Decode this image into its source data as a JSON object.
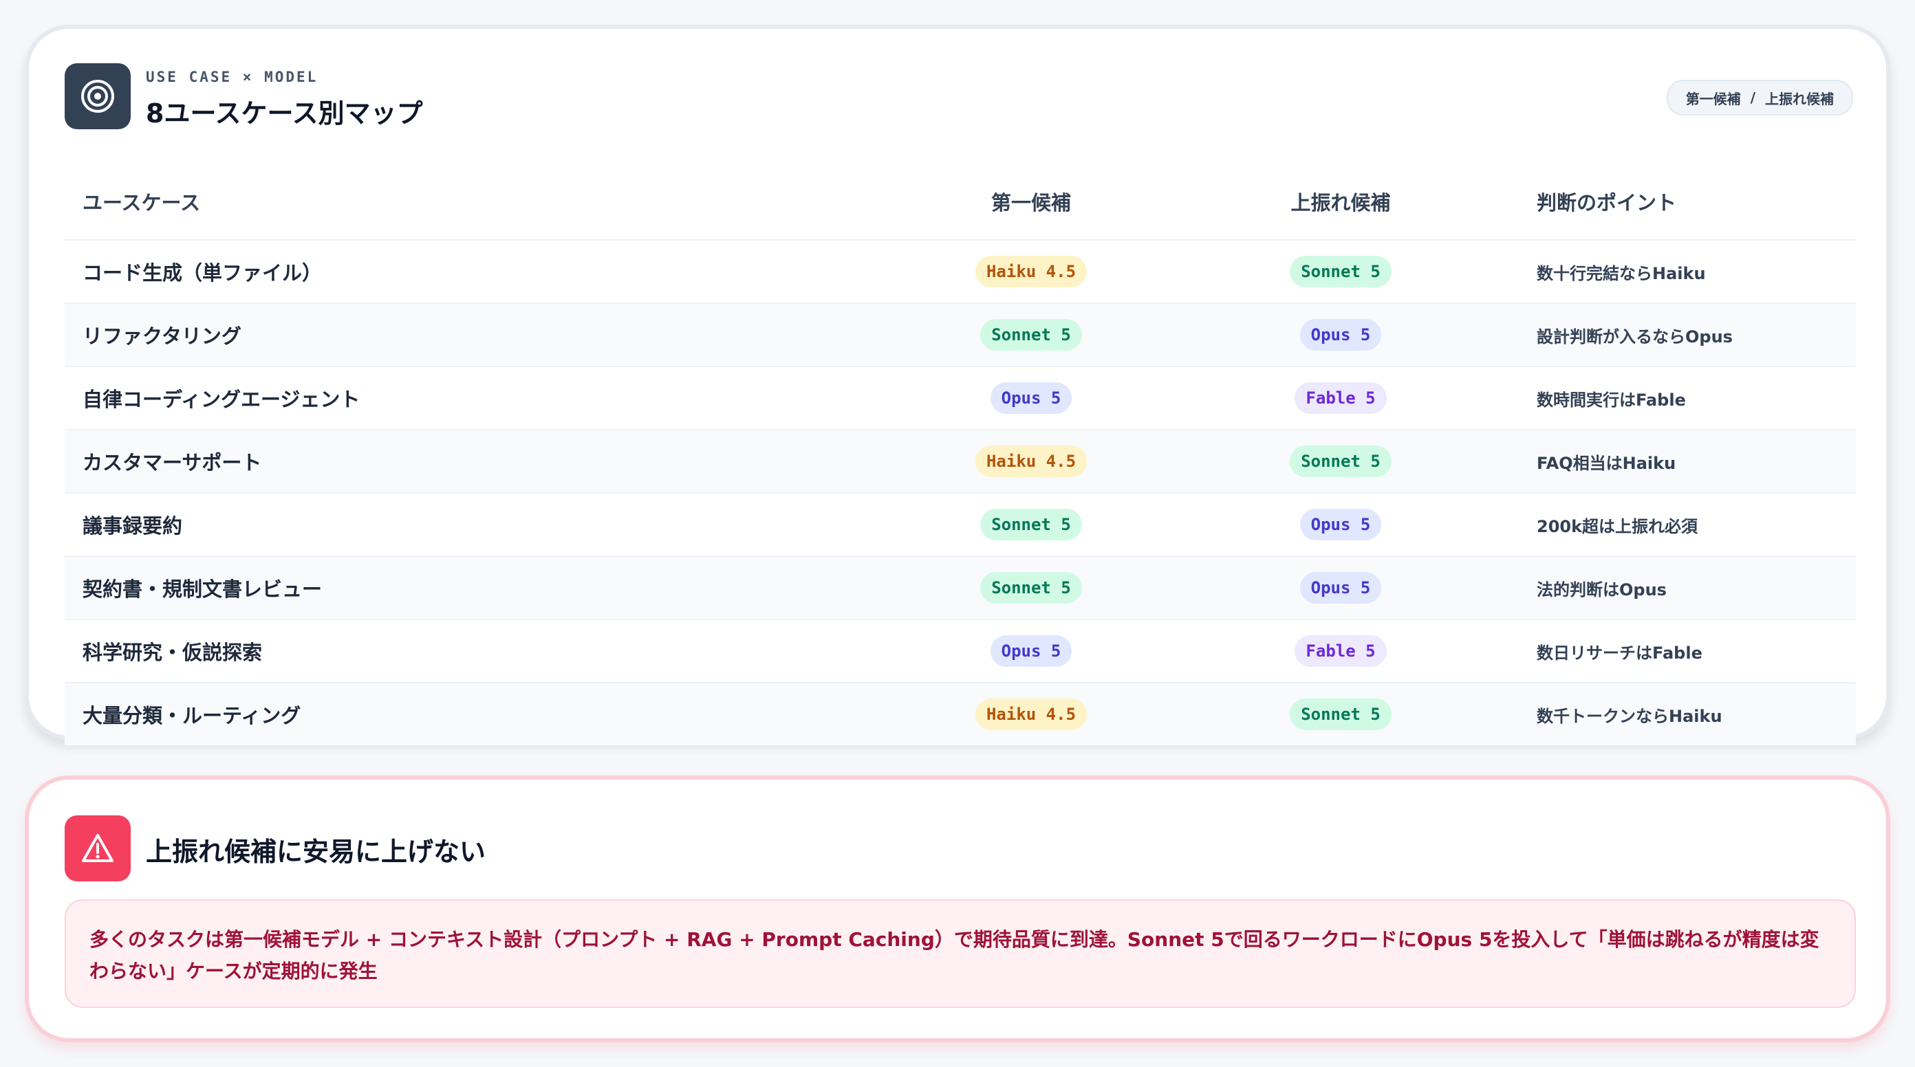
{
  "header": {
    "eyebrow": "USE CASE × MODEL",
    "title": "8ユースケース別マップ",
    "icon": "target-icon",
    "legend": {
      "primary": "第一候補",
      "separator": "/",
      "upgrade": "上振れ候補"
    }
  },
  "table": {
    "columns": [
      "ユースケース",
      "第一候補",
      "上振れ候補",
      "判断のポイント"
    ],
    "rows": [
      {
        "use_case": "コード生成（単ファイル）",
        "primary": "Haiku 4.5",
        "upgrade": "Sonnet 5",
        "point": "数十行完結ならHaiku"
      },
      {
        "use_case": "リファクタリング",
        "primary": "Sonnet 5",
        "upgrade": "Opus 5",
        "point": "設計判断が入るならOpus"
      },
      {
        "use_case": "自律コーディングエージェント",
        "primary": "Opus 5",
        "upgrade": "Fable 5",
        "point": "数時間実行はFable"
      },
      {
        "use_case": "カスタマーサポート",
        "primary": "Haiku 4.5",
        "upgrade": "Sonnet 5",
        "point": "FAQ相当はHaiku"
      },
      {
        "use_case": "議事録要約",
        "primary": "Sonnet 5",
        "upgrade": "Opus 5",
        "point": "200k超は上振れ必須"
      },
      {
        "use_case": "契約書・規制文書レビュー",
        "primary": "Sonnet 5",
        "upgrade": "Opus 5",
        "point": "法的判断はOpus"
      },
      {
        "use_case": "科学研究・仮説探索",
        "primary": "Opus 5",
        "upgrade": "Fable 5",
        "point": "数日リサーチはFable"
      },
      {
        "use_case": "大量分類・ルーティング",
        "primary": "Haiku 4.5",
        "upgrade": "Sonnet 5",
        "point": "数千トークンならHaiku"
      }
    ]
  },
  "warning": {
    "icon": "warning-icon",
    "title": "上振れ候補に安易に上げない",
    "body": "多くのタスクは第一候補モデル + コンテキスト設計（プロンプト + RAG + Prompt Caching）で期待品質に到達。Sonnet 5で回るワークロードにOpus 5を投入して「単価は跳ねるが精度は変わらない」ケースが定期的に発生"
  },
  "colors": {
    "haiku": "#b45309",
    "sonnet": "#047857",
    "opus": "#4338ca",
    "fable": "#6d28d9",
    "warning_accent": "#f43f5e"
  }
}
